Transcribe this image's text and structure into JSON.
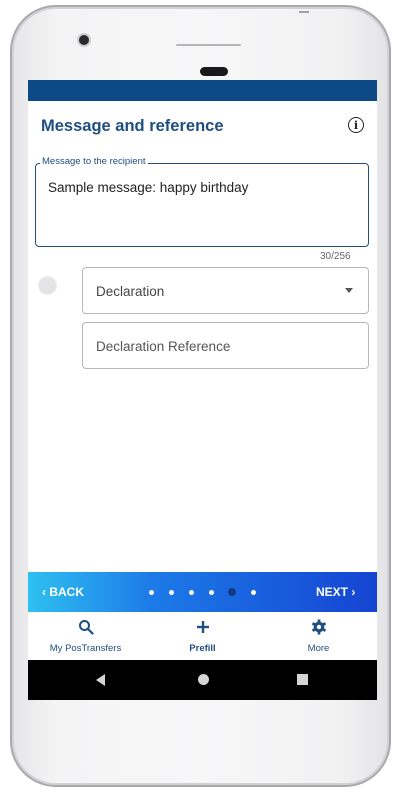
{
  "header": {
    "title": "Message and reference",
    "info_icon": "info-icon"
  },
  "message": {
    "label": "Message to the recipient",
    "value": "Sample message: happy birthday",
    "counter": "30/256"
  },
  "declaration": {
    "select_value": "Declaration",
    "reference_placeholder": "Declaration Reference"
  },
  "stepper": {
    "back_label": "‹ BACK",
    "next_label": "NEXT ›",
    "total_steps": 6,
    "current_step": 5,
    "gradient_colors": [
      "#2ec0f0",
      "#1d7be8",
      "#1544d2"
    ]
  },
  "tabs": [
    {
      "label": "My PosTransfers",
      "icon": "search-icon"
    },
    {
      "label": "Prefill",
      "icon": "plus-icon",
      "active": true
    },
    {
      "label": "More",
      "icon": "gear-icon"
    }
  ],
  "colors": {
    "primary": "#1f4e80",
    "statusbar": "#0d4a85"
  }
}
